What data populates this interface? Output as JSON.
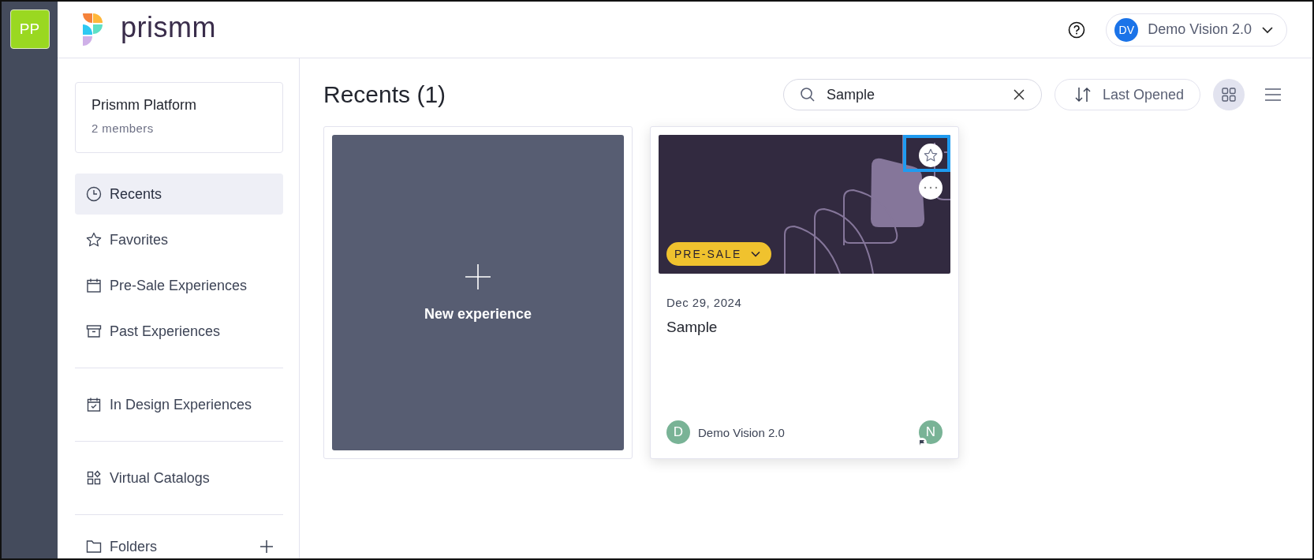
{
  "workspace_badge": "PP",
  "logo": {
    "text": "prismm"
  },
  "header": {
    "user": {
      "initials": "DV",
      "name": "Demo Vision 2.0"
    }
  },
  "sidebar": {
    "workspace": {
      "name": "Prismm Platform",
      "members": "2 members"
    },
    "groups": [
      [
        {
          "label": "Recents",
          "kind": "clock",
          "selected": true
        },
        {
          "label": "Favorites",
          "kind": "star",
          "selected": false
        },
        {
          "label": "Pre-Sale Experiences",
          "kind": "calendar",
          "selected": false
        },
        {
          "label": "Past Experiences",
          "kind": "archive",
          "selected": false
        }
      ],
      [
        {
          "label": "In Design Experiences",
          "kind": "calendar-check",
          "selected": false
        }
      ],
      [
        {
          "label": "Virtual Catalogs",
          "kind": "shapes",
          "selected": false
        }
      ]
    ],
    "folders": {
      "label": "Folders"
    }
  },
  "main": {
    "title": "Recents (1)",
    "search": {
      "value": "Sample"
    },
    "sort": {
      "label": "Last Opened"
    },
    "views": [
      {
        "kind": "grid",
        "selected": true
      },
      {
        "kind": "list",
        "selected": false
      }
    ],
    "new_card": {
      "label": "New experience"
    },
    "cards": [
      {
        "tag": "PRE-SALE",
        "date": "Dec 29, 2024",
        "title": "Sample",
        "favorite": false,
        "owner": {
          "initial": "D",
          "name": "Demo Vision 2.0"
        },
        "collaborator": {
          "initial": "N"
        }
      }
    ]
  }
}
